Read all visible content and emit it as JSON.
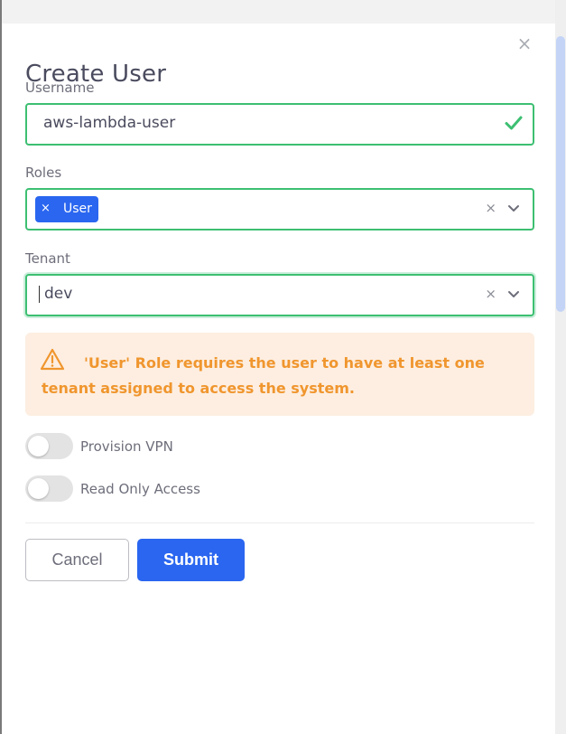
{
  "dialog": {
    "title": "Create User",
    "close_glyph": "×"
  },
  "username": {
    "label": "Username",
    "value": "aws-lambda-user",
    "status_icon": "check-icon"
  },
  "roles": {
    "label": "Roles",
    "selected": [
      {
        "label": "User",
        "remove_glyph": "×"
      }
    ],
    "clear_glyph": "×",
    "dropdown_icon": "chevron-down-icon"
  },
  "tenant": {
    "label": "Tenant",
    "value": "dev",
    "clear_glyph": "×",
    "dropdown_icon": "chevron-down-icon"
  },
  "alert": {
    "icon": "warning-triangle-icon",
    "message": "'User' Role requires the user to have at least one tenant assigned to access the system."
  },
  "toggles": {
    "provision_vpn": {
      "label": "Provision VPN",
      "enabled": false
    },
    "read_only": {
      "label": "Read Only Access",
      "enabled": false
    }
  },
  "actions": {
    "cancel_label": "Cancel",
    "submit_label": "Submit"
  },
  "colors": {
    "accent": "#2a66f0",
    "valid_border": "#3dbf72",
    "warning_text": "#f0962e",
    "warning_bg": "#fdeee1"
  }
}
